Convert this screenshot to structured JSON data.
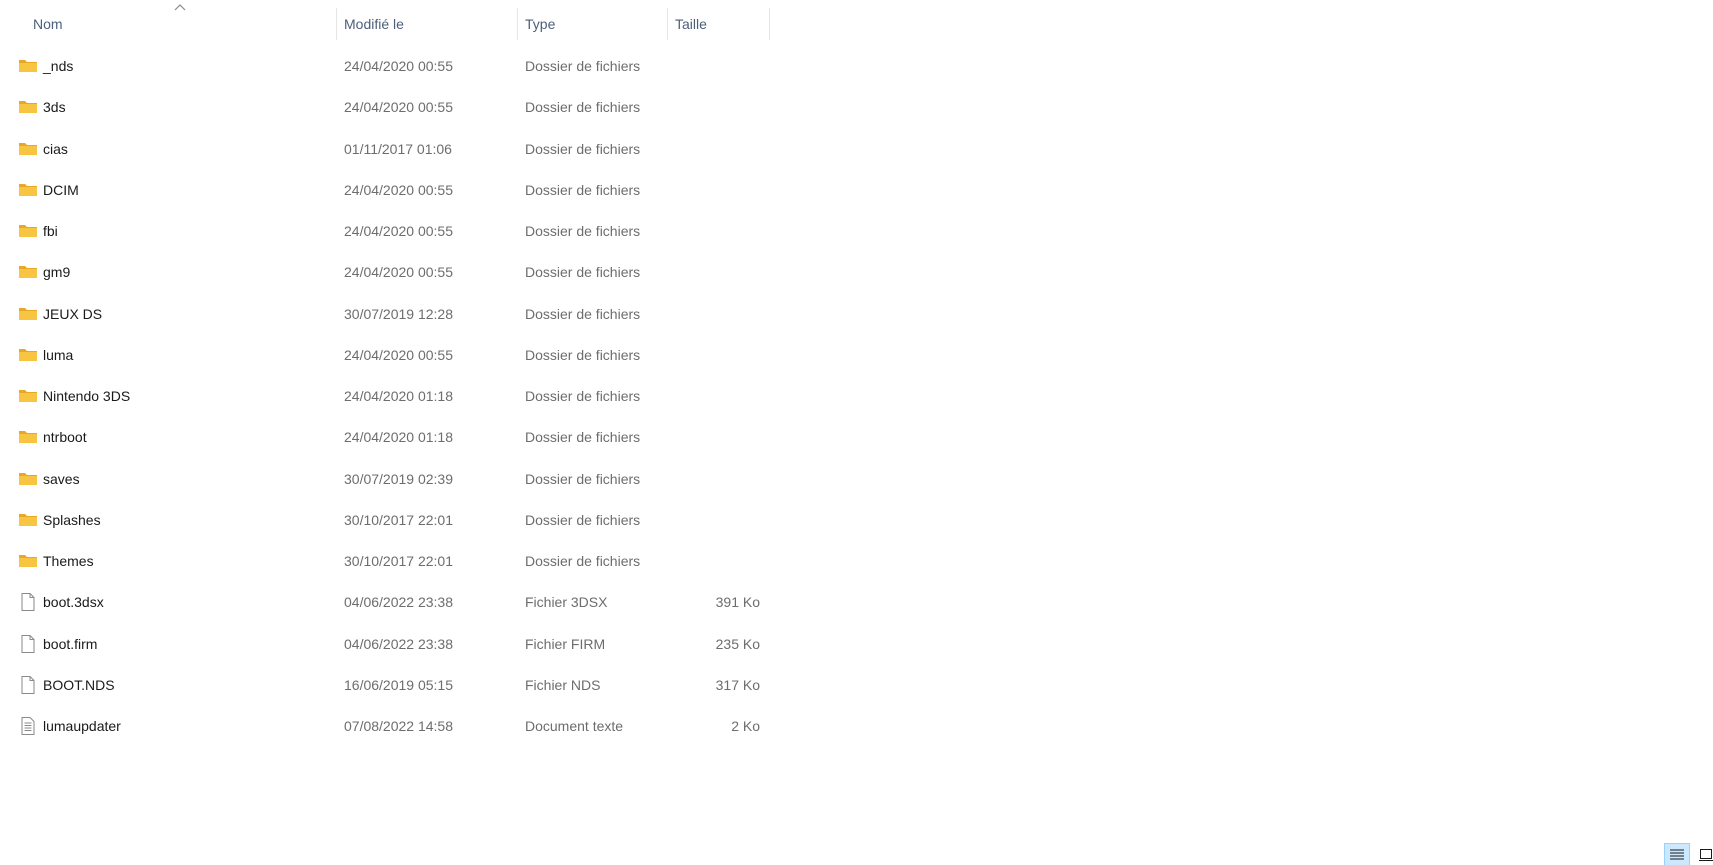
{
  "columns": {
    "name": "Nom",
    "modified": "Modifié le",
    "type": "Type",
    "size": "Taille",
    "sort_indicator": "chevron-up-icon"
  },
  "rows": [
    {
      "name": "_nds",
      "modified": "24/04/2020 00:55",
      "type": "Dossier de fichiers",
      "size": "",
      "icon": "folder-icon"
    },
    {
      "name": "3ds",
      "modified": "24/04/2020 00:55",
      "type": "Dossier de fichiers",
      "size": "",
      "icon": "folder-icon"
    },
    {
      "name": "cias",
      "modified": "01/11/2017 01:06",
      "type": "Dossier de fichiers",
      "size": "",
      "icon": "folder-icon"
    },
    {
      "name": "DCIM",
      "modified": "24/04/2020 00:55",
      "type": "Dossier de fichiers",
      "size": "",
      "icon": "folder-icon"
    },
    {
      "name": "fbi",
      "modified": "24/04/2020 00:55",
      "type": "Dossier de fichiers",
      "size": "",
      "icon": "folder-icon"
    },
    {
      "name": "gm9",
      "modified": "24/04/2020 00:55",
      "type": "Dossier de fichiers",
      "size": "",
      "icon": "folder-icon"
    },
    {
      "name": "JEUX DS",
      "modified": "30/07/2019 12:28",
      "type": "Dossier de fichiers",
      "size": "",
      "icon": "folder-icon"
    },
    {
      "name": "luma",
      "modified": "24/04/2020 00:55",
      "type": "Dossier de fichiers",
      "size": "",
      "icon": "folder-icon"
    },
    {
      "name": "Nintendo 3DS",
      "modified": "24/04/2020 01:18",
      "type": "Dossier de fichiers",
      "size": "",
      "icon": "folder-icon"
    },
    {
      "name": "ntrboot",
      "modified": "24/04/2020 01:18",
      "type": "Dossier de fichiers",
      "size": "",
      "icon": "folder-icon"
    },
    {
      "name": "saves",
      "modified": "30/07/2019 02:39",
      "type": "Dossier de fichiers",
      "size": "",
      "icon": "folder-icon"
    },
    {
      "name": "Splashes",
      "modified": "30/10/2017 22:01",
      "type": "Dossier de fichiers",
      "size": "",
      "icon": "folder-icon"
    },
    {
      "name": "Themes",
      "modified": "30/10/2017 22:01",
      "type": "Dossier de fichiers",
      "size": "",
      "icon": "folder-icon"
    },
    {
      "name": "boot.3dsx",
      "modified": "04/06/2022 23:38",
      "type": "Fichier 3DSX",
      "size": "391 Ko",
      "icon": "file-icon"
    },
    {
      "name": "boot.firm",
      "modified": "04/06/2022 23:38",
      "type": "Fichier FIRM",
      "size": "235 Ko",
      "icon": "file-icon"
    },
    {
      "name": "BOOT.NDS",
      "modified": "16/06/2019 05:15",
      "type": "Fichier NDS",
      "size": "317 Ko",
      "icon": "file-icon"
    },
    {
      "name": "lumaupdater",
      "modified": "07/08/2022 14:58",
      "type": "Document texte",
      "size": "2 Ko",
      "icon": "text-document-icon"
    }
  ],
  "view_toggles": {
    "details_icon": "details-view-icon",
    "tiles_icon": "large-icons-view-icon",
    "active": "details"
  },
  "colors": {
    "header_text": "#4c607a",
    "secondary_text": "#6d6d6d",
    "folder": "#f8c542",
    "folder_dark": "#e8a825",
    "active_toggle_bg": "#cce8ff",
    "active_toggle_border": "#99d1ff"
  }
}
